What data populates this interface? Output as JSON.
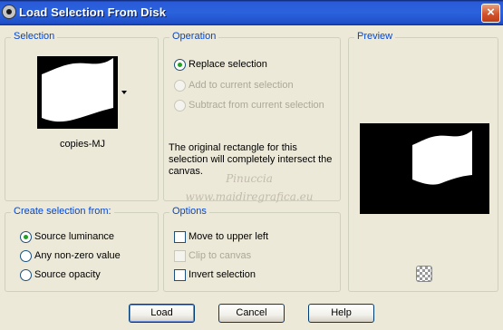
{
  "window": {
    "title": "Load Selection From Disk",
    "close_label": "×"
  },
  "selection_group": {
    "title": "Selection",
    "selected_name": "copies-MJ"
  },
  "operation_group": {
    "title": "Operation",
    "options": [
      {
        "label": "Replace selection",
        "checked": true,
        "enabled": true
      },
      {
        "label": "Add to current selection",
        "checked": false,
        "enabled": false
      },
      {
        "label": "Subtract from current selection",
        "checked": false,
        "enabled": false
      }
    ],
    "note": "The original rectangle for this selection will completely intersect the canvas."
  },
  "preview_group": {
    "title": "Preview"
  },
  "create_group": {
    "title": "Create selection from:",
    "options": [
      {
        "label": "Source luminance",
        "checked": true
      },
      {
        "label": "Any non-zero value",
        "checked": false
      },
      {
        "label": "Source opacity",
        "checked": false
      }
    ]
  },
  "options_group": {
    "title": "Options",
    "options": [
      {
        "label": "Move to upper left",
        "checked": false,
        "enabled": true
      },
      {
        "label": "Clip to canvas",
        "checked": false,
        "enabled": false
      },
      {
        "label": "Invert selection",
        "checked": false,
        "enabled": true
      }
    ]
  },
  "watermark": {
    "line1": "Pinuccia",
    "line2": "www.maidiregrafica.eu"
  },
  "buttons": {
    "load": "Load",
    "cancel": "Cancel",
    "help": "Help"
  }
}
